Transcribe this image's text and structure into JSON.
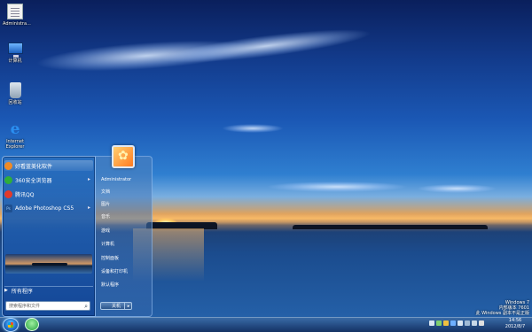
{
  "desktop": {
    "icons": [
      {
        "label": "Administra...",
        "icon": "document-icon"
      },
      {
        "label": "计算机",
        "icon": "computer-icon"
      },
      {
        "label": "回收站",
        "icon": "recycle-bin-icon"
      },
      {
        "label": "Internet\nExplorer",
        "icon": "internet-explorer-icon"
      }
    ]
  },
  "start_menu": {
    "programs": [
      {
        "label": "好看蓝美化软件",
        "icon": "beautify-app-icon",
        "color": "#f08a24",
        "has_submenu": false
      },
      {
        "label": "360安全浏览器",
        "icon": "360-browser-icon",
        "color": "#2fae3a",
        "has_submenu": true
      },
      {
        "label": "腾讯QQ",
        "icon": "qq-icon",
        "color": "#e23a2a",
        "has_submenu": false
      },
      {
        "label": "Adobe Photoshop CS5",
        "icon": "photoshop-icon",
        "color": "#1e4f8f",
        "has_submenu": true
      }
    ],
    "all_programs": "所有程序",
    "search_placeholder": "搜索程序和文件",
    "user_name": "Administrator",
    "places": [
      "文档",
      "图片",
      "音乐",
      "游戏",
      "计算机",
      "控制面板",
      "设备和打印机",
      "默认程序"
    ],
    "shutdown_label": "关机"
  },
  "watermark": {
    "line1": "Windows 7",
    "line2": "内部版本 7601",
    "line3": "此 Windows 副本不是正版"
  },
  "taskbar": {
    "time": "14:56",
    "date": "2012/8/7"
  },
  "colors": {
    "taskbar": "#1e4a8a",
    "start_menu": "#2a6fbd",
    "sky": "#1b58b5"
  }
}
